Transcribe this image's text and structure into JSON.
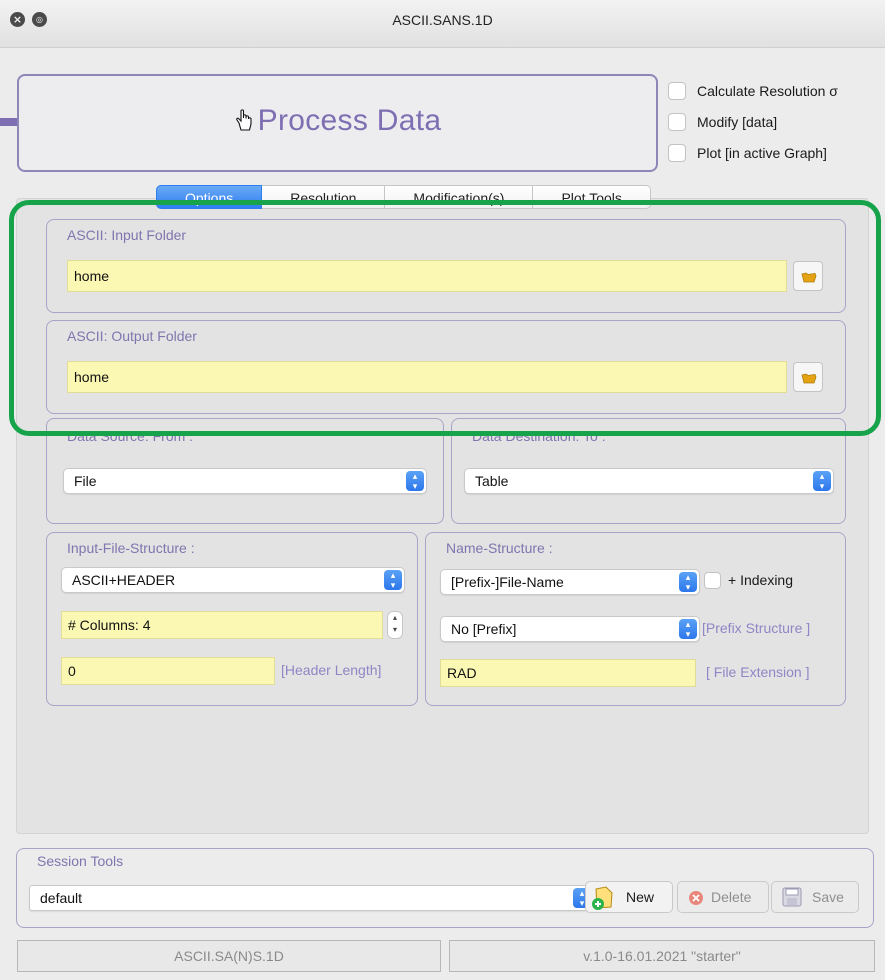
{
  "window": {
    "title": "ASCII.SANS.1D"
  },
  "process": {
    "label": "Process Data"
  },
  "options_checks": [
    {
      "label": "Calculate Resolution σ",
      "checked": false
    },
    {
      "label": "Modify [data]",
      "checked": false
    },
    {
      "label": "Plot [in active Graph]",
      "checked": false
    }
  ],
  "tabs": [
    {
      "label": "Options",
      "active": true
    },
    {
      "label": "Resolution",
      "active": false
    },
    {
      "label": "Modification(s)",
      "active": false
    },
    {
      "label": "Plot Tools",
      "active": false
    }
  ],
  "input_folder": {
    "title": "ASCII: Input Folder",
    "value": "home"
  },
  "output_folder": {
    "title": "ASCII: Output Folder",
    "value": "home"
  },
  "data_source": {
    "title": "Data Source: From :",
    "value": "File"
  },
  "data_destination": {
    "title": "Data Destination: To :",
    "value": "Table"
  },
  "input_structure": {
    "title": "Input-File-Structure :",
    "format": "ASCII+HEADER",
    "columns": "# Columns:  4",
    "header_length": "0",
    "header_length_label": "[Header Length]"
  },
  "name_structure": {
    "title": "Name-Structure :",
    "pattern": "[Prefix-]File-Name",
    "indexing_label": "+ Indexing",
    "prefix": "No [Prefix]",
    "prefix_label": "[Prefix Structure ]",
    "extension": "RAD",
    "extension_label": "[ File Extension ]"
  },
  "session": {
    "title": "Session Tools",
    "value": "default",
    "new_label": "New",
    "delete_label": "Delete",
    "save_label": "Save"
  },
  "status": {
    "left": "ASCII.SA(N)S.1D",
    "right": "v.1.0-16.01.2021 \"starter\""
  },
  "colors": {
    "accent": "#2f7ef0",
    "annotation_green": "#16a34a",
    "annotation_arrow": "#7e6fb2",
    "field_yellow": "#fbf8b4",
    "group_title": "#8075ae"
  }
}
